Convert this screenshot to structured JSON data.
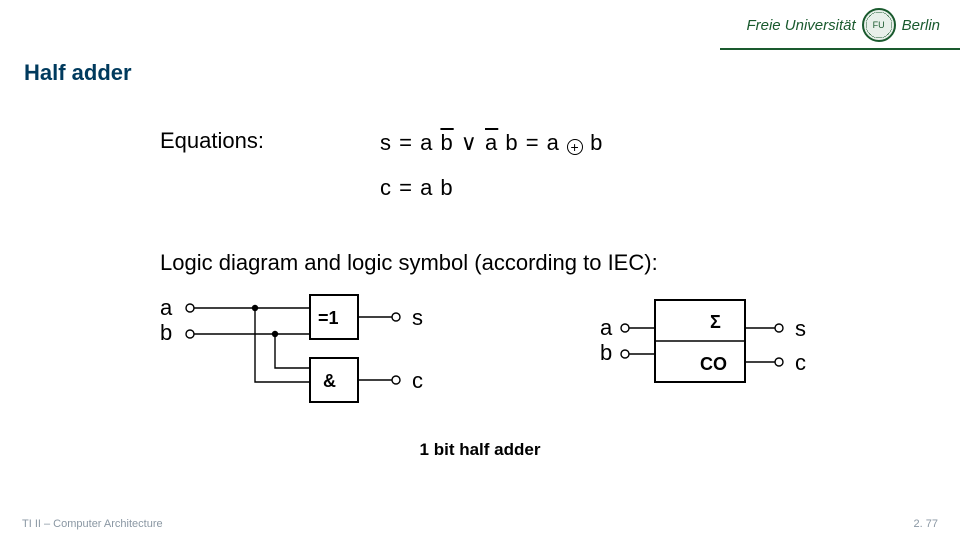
{
  "logo": {
    "uni": "Freie Universität",
    "city": "Berlin",
    "seal": "FU"
  },
  "title": "Half adder",
  "equations": {
    "label": "Equations:",
    "s_lhs": "s = ",
    "s_term1a": "a ",
    "s_term1b_bar": "b",
    "s_or": " ∨ ",
    "s_term2a_bar": "a",
    "s_term2b": " b = a ",
    "s_xor_glyph": "+",
    "s_rhs": " b",
    "c": "c = a b"
  },
  "body": "Logic diagram and logic symbol (according to IEC):",
  "gate_diagram": {
    "in_a": "a",
    "in_b": "b",
    "xor_label": "=1",
    "and_label": "&",
    "out_s": "s",
    "out_c": "c"
  },
  "block_symbol": {
    "in_a": "a",
    "in_b": "b",
    "sigma": "Σ",
    "co": "CO",
    "out_s": "s",
    "out_c": "c"
  },
  "caption": "1 bit half adder",
  "footer": {
    "left": "TI II – Computer Architecture",
    "right": "2. 77"
  }
}
